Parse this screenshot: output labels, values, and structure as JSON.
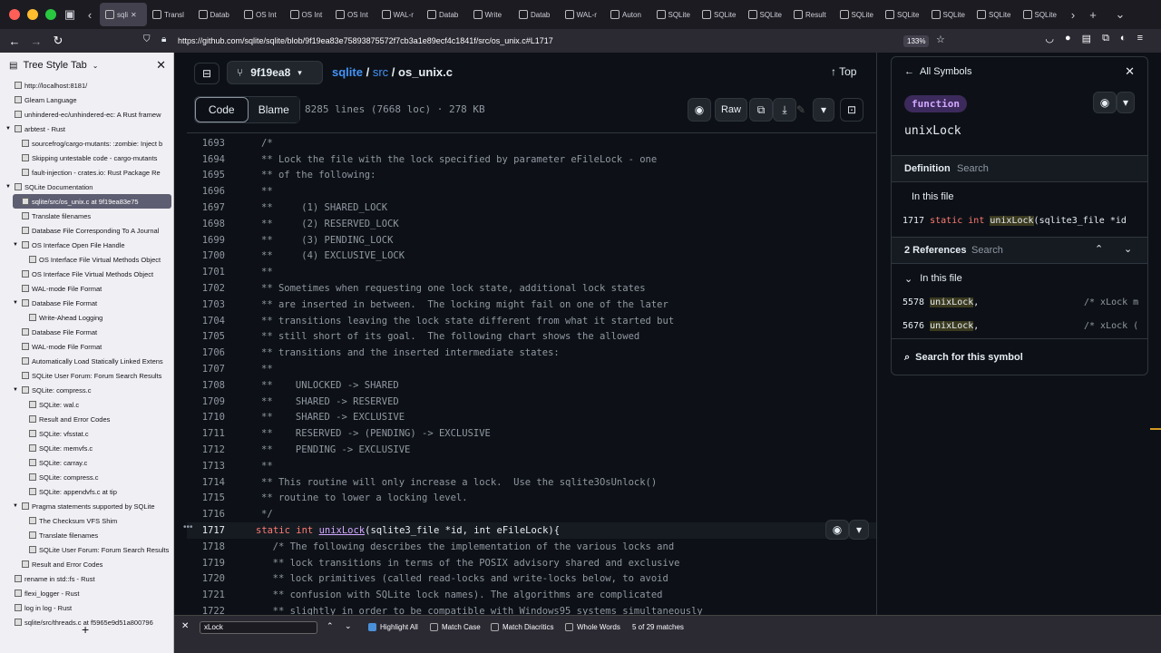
{
  "browser": {
    "tabs": [
      "sqli",
      "Transl",
      "Datab",
      "OS Int",
      "OS Int",
      "OS Int",
      "WAL-r",
      "Datab",
      "Write",
      "Datab",
      "WAL-r",
      "Auton",
      "SQLite",
      "SQLite",
      "SQLite",
      "Result",
      "SQLite",
      "SQLite",
      "SQLite",
      "SQLite",
      "SQLite"
    ],
    "url": "https://github.com/sqlite/sqlite/blob/9f19ea83e75893875572f7cb3a1e89ecf4c1841f/src/os_unix.c#L1717",
    "zoom": "133%"
  },
  "sidebar": {
    "title": "Tree Style Tab",
    "items": [
      {
        "label": "http://localhost:8181/",
        "indent": 0
      },
      {
        "label": "Gleam Language",
        "indent": 0
      },
      {
        "label": "unhindered-ec/unhindered-ec: A Rust framew",
        "indent": 0
      },
      {
        "label": "arbtest - Rust",
        "indent": 0,
        "arrow": "v"
      },
      {
        "label": "sourcefrog/cargo-mutants: :zombie: Inject b",
        "indent": 1
      },
      {
        "label": "Skipping untestable code - cargo-mutants",
        "indent": 1
      },
      {
        "label": "fault-injection - crates.io: Rust Package Re",
        "indent": 1
      },
      {
        "label": "SQLite Documentation",
        "indent": 0,
        "arrow": "v"
      },
      {
        "label": "sqlite/src/os_unix.c at 9f19ea83e75",
        "indent": 1,
        "active": true
      },
      {
        "label": "Translate filenames",
        "indent": 1
      },
      {
        "label": "Database File Corresponding To A Journal",
        "indent": 1
      },
      {
        "label": "OS Interface Open File Handle",
        "indent": 1,
        "arrow": "v"
      },
      {
        "label": "OS Interface File Virtual Methods Object",
        "indent": 2
      },
      {
        "label": "OS Interface File Virtual Methods Object",
        "indent": 1
      },
      {
        "label": "WAL-mode File Format",
        "indent": 1
      },
      {
        "label": "Database File Format",
        "indent": 1,
        "arrow": "v"
      },
      {
        "label": "Write-Ahead Logging",
        "indent": 2
      },
      {
        "label": "Database File Format",
        "indent": 1
      },
      {
        "label": "WAL-mode File Format",
        "indent": 1
      },
      {
        "label": "Automatically Load Statically Linked Extens",
        "indent": 1
      },
      {
        "label": "SQLite User Forum: Forum Search Results",
        "indent": 1
      },
      {
        "label": "SQLite: compress.c",
        "indent": 1,
        "arrow": "v"
      },
      {
        "label": "SQLite: wal.c",
        "indent": 2
      },
      {
        "label": "Result and Error Codes",
        "indent": 2
      },
      {
        "label": "SQLite: vfsstat.c",
        "indent": 2
      },
      {
        "label": "SQLite: memvfs.c",
        "indent": 2
      },
      {
        "label": "SQLite: carray.c",
        "indent": 2
      },
      {
        "label": "SQLite: compress.c",
        "indent": 2
      },
      {
        "label": "SQLite: appendvfs.c at tip",
        "indent": 2
      },
      {
        "label": "Pragma statements supported by SQLite",
        "indent": 1,
        "arrow": "v"
      },
      {
        "label": "The Checksum VFS Shim",
        "indent": 2
      },
      {
        "label": "Translate filenames",
        "indent": 2
      },
      {
        "label": "SQLite User Forum: Forum Search Results",
        "indent": 2
      },
      {
        "label": "Result and Error Codes",
        "indent": 1
      },
      {
        "label": "rename in std::fs - Rust",
        "indent": 0
      },
      {
        "label": "flexi_logger - Rust",
        "indent": 0
      },
      {
        "label": "log in log - Rust",
        "indent": 0
      },
      {
        "label": "sqlite/src/threads.c at f5965e9d51a800796",
        "indent": 0
      }
    ]
  },
  "repo": {
    "branch": "9f19ea8",
    "crumb_repo": "sqlite",
    "crumb_dir": "src",
    "crumb_file": "os_unix.c",
    "top_label": "Top",
    "tab_code": "Code",
    "tab_blame": "Blame",
    "meta": "8285 lines (7668 loc) · 278 KB",
    "raw_label": "Raw"
  },
  "code_lines": [
    {
      "n": "1693",
      "t": "/*"
    },
    {
      "n": "1694",
      "t": "** Lock the file with the lock specified by parameter eFileLock - one"
    },
    {
      "n": "1695",
      "t": "** of the following:"
    },
    {
      "n": "1696",
      "t": "**"
    },
    {
      "n": "1697",
      "t": "**     (1) SHARED_LOCK"
    },
    {
      "n": "1698",
      "t": "**     (2) RESERVED_LOCK"
    },
    {
      "n": "1699",
      "t": "**     (3) PENDING_LOCK"
    },
    {
      "n": "1700",
      "t": "**     (4) EXCLUSIVE_LOCK"
    },
    {
      "n": "1701",
      "t": "**"
    },
    {
      "n": "1702",
      "t": "** Sometimes when requesting one lock state, additional lock states"
    },
    {
      "n": "1703",
      "t": "** are inserted in between.  The locking might fail on one of the later"
    },
    {
      "n": "1704",
      "t": "** transitions leaving the lock state different from what it started but"
    },
    {
      "n": "1705",
      "t": "** still short of its goal.  The following chart shows the allowed"
    },
    {
      "n": "1706",
      "t": "** transitions and the inserted intermediate states:"
    },
    {
      "n": "1707",
      "t": "**"
    },
    {
      "n": "1708",
      "t": "**    UNLOCKED -> SHARED"
    },
    {
      "n": "1709",
      "t": "**    SHARED -> RESERVED"
    },
    {
      "n": "1710",
      "t": "**    SHARED -> EXCLUSIVE"
    },
    {
      "n": "1711",
      "t": "**    RESERVED -> (PENDING) -> EXCLUSIVE"
    },
    {
      "n": "1712",
      "t": "**    PENDING -> EXCLUSIVE"
    },
    {
      "n": "1713",
      "t": "**"
    },
    {
      "n": "1714",
      "t": "** This routine will only increase a lock.  Use the sqlite3OsUnlock()"
    },
    {
      "n": "1715",
      "t": "** routine to lower a locking level."
    },
    {
      "n": "1716",
      "t": "*/"
    },
    {
      "n": "1717",
      "t": "",
      "kw1": "static",
      "kw2": "int",
      "fn": "unixLock",
      "rest": "(sqlite3_file *id, int eFileLock){",
      "current": true
    },
    {
      "n": "1718",
      "t": "  /* The following describes the implementation of the various locks and"
    },
    {
      "n": "1719",
      "t": "  ** lock transitions in terms of the POSIX advisory shared and exclusive"
    },
    {
      "n": "1720",
      "t": "  ** lock primitives (called read-locks and write-locks below, to avoid"
    },
    {
      "n": "1721",
      "t": "  ** confusion with SQLite lock names). The algorithms are complicated"
    },
    {
      "n": "1722",
      "t": "  ** slightly in order to be compatible with Windows95 systems simultaneously"
    }
  ],
  "symbols": {
    "back_label": "All Symbols",
    "kind": "function",
    "name": "unixLock",
    "def_tab": "Definition",
    "search_tab": "Search",
    "in_file": "In this file",
    "def_line": "1717",
    "def_kw1": "static",
    "def_kw2": "int",
    "def_fn": "unixLock",
    "def_rest": "(sqlite3_file *id",
    "refs_label": "2 References",
    "refs_search": "Search",
    "refs_in_file": "In this file",
    "refs": [
      {
        "line": "5578",
        "fn": "unixLock",
        "rest": ",",
        "comment": "/* xLock m"
      },
      {
        "line": "5676",
        "fn": "unixLock",
        "rest": ",",
        "comment": "/* xLock ("
      }
    ],
    "search_symbol": "Search for this symbol"
  },
  "findbar": {
    "query": "xLock",
    "highlight_all": "Highlight All",
    "match_case": "Match Case",
    "match_diacritics": "Match Diacritics",
    "whole_words": "Whole Words",
    "status": "5 of 29 matches"
  }
}
